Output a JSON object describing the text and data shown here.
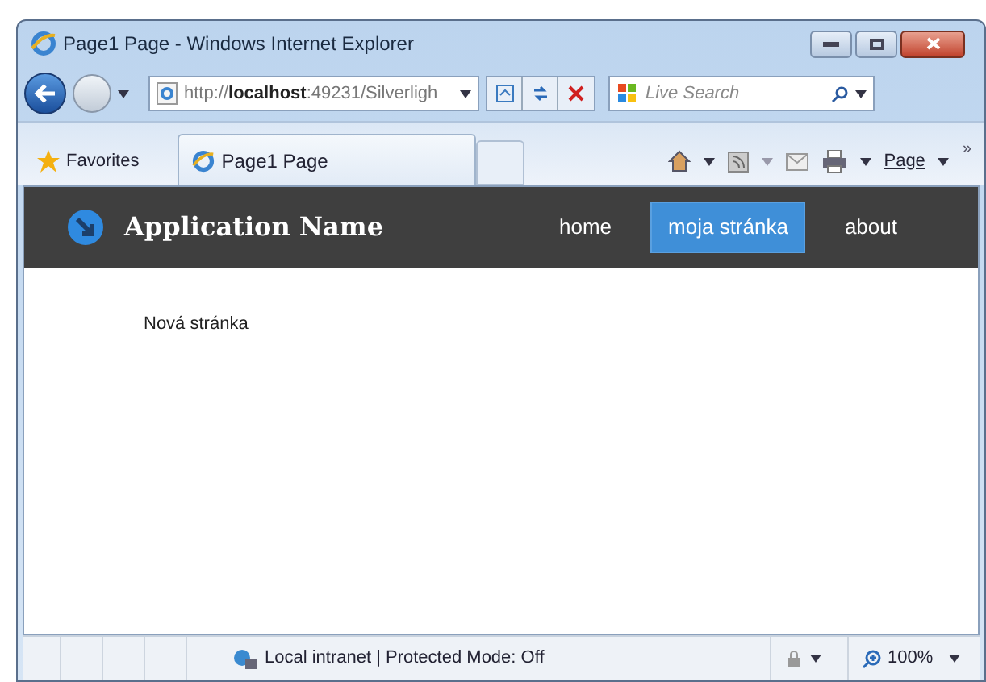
{
  "window": {
    "title": "Page1 Page - Windows Internet Explorer"
  },
  "address_bar": {
    "prefix": "http://",
    "host": "localhost",
    "rest": ":49231/Silverligh"
  },
  "search": {
    "placeholder": "Live Search"
  },
  "favorites": {
    "label": "Favorites"
  },
  "tab": {
    "label": "Page1 Page"
  },
  "command_bar": {
    "page_menu": "Page",
    "more": "»"
  },
  "app": {
    "name": "Application Name",
    "nav": [
      {
        "label": "home",
        "selected": false
      },
      {
        "label": "moja stránka",
        "selected": true
      },
      {
        "label": "about",
        "selected": false
      }
    ],
    "content": "Nová stránka"
  },
  "status_bar": {
    "zone": "Local intranet | Protected Mode: Off",
    "zoom": "100%"
  }
}
